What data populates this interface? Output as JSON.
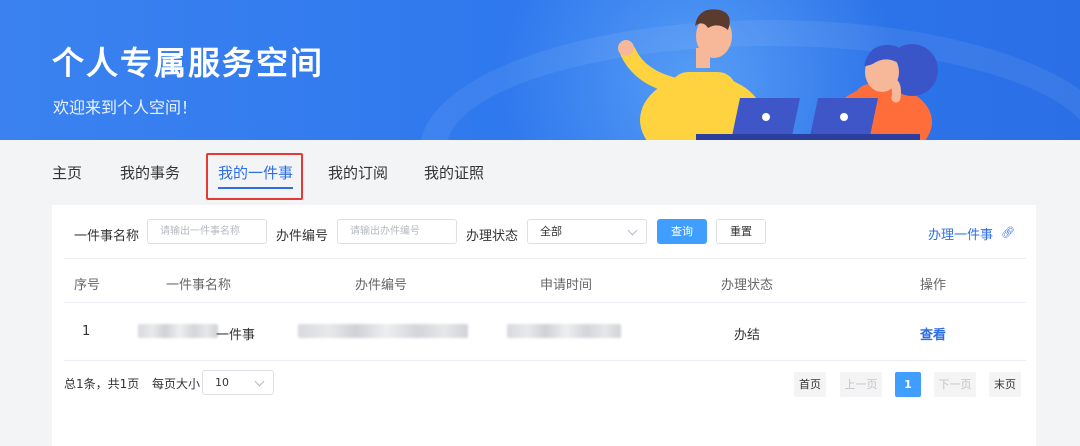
{
  "banner": {
    "title": "个人专属服务空间",
    "subtitle": "欢迎来到个人空间！"
  },
  "tabs": [
    {
      "label": "主页",
      "active": false
    },
    {
      "label": "我的事务",
      "active": false
    },
    {
      "label": "我的一件事",
      "active": true
    },
    {
      "label": "我的订阅",
      "active": false
    },
    {
      "label": "我的证照",
      "active": false
    }
  ],
  "filters": {
    "name_label": "一件事名称",
    "name_placeholder": "请输出一件事名称",
    "code_label": "办件编号",
    "code_placeholder": "请输出办件编号",
    "status_label": "办理状态",
    "status_value": "全部",
    "query_button": "查询",
    "reset_button": "重置",
    "handle_link": "办理一件事"
  },
  "table": {
    "columns": [
      "序号",
      "一件事名称",
      "办件编号",
      "申请时间",
      "办理状态",
      "操作"
    ],
    "rows": [
      {
        "index": "1",
        "name_suffix": "一件事",
        "status": "办结",
        "action": "查看"
      }
    ]
  },
  "pagination": {
    "total_text": "总1条，共1页",
    "page_size_label": "每页大小",
    "page_size_value": "10",
    "first": "首页",
    "prev": "上一页",
    "current": "1",
    "next": "下一页",
    "last": "末页"
  },
  "colors": {
    "accent": "#2f6fe6",
    "primary_button": "#409eff",
    "highlight": "#e53935"
  }
}
